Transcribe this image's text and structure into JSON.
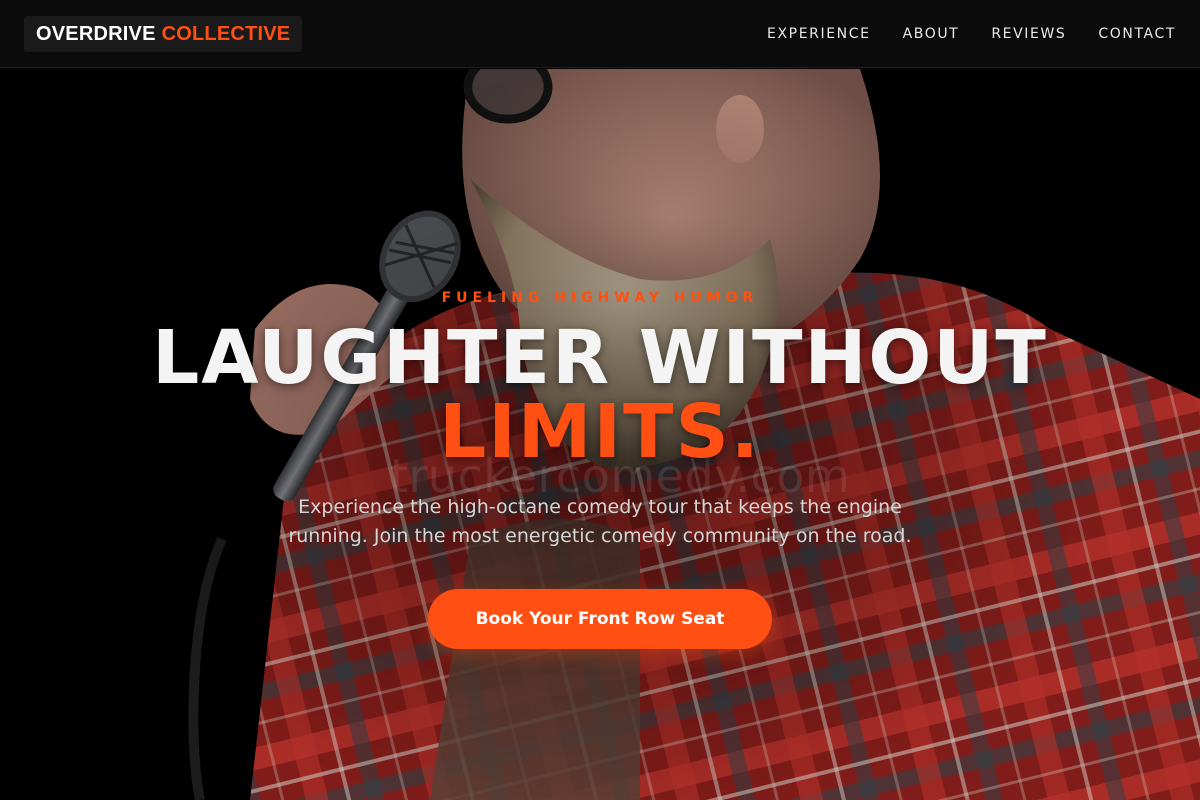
{
  "header": {
    "brand_primary": "OVERDRIVE",
    "brand_accent": "COLLECTIVE",
    "nav": [
      {
        "label": "EXPERIENCE"
      },
      {
        "label": "ABOUT"
      },
      {
        "label": "REVIEWS"
      },
      {
        "label": "CONTACT"
      }
    ]
  },
  "hero": {
    "eyebrow": "FUELING HIGHWAY HUMOR",
    "headline_main": "LAUGHTER WITHOUT",
    "headline_accent": "LIMITS.",
    "subtitle": "Experience the high-octane comedy tour that keeps the engine running. Join the most energetic comedy community on the road.",
    "cta_label": "Book Your Front Row Seat",
    "watermark": "truckercomedy.com",
    "background": "Comedian with beard and glasses holding a microphone, wearing a red plaid flannel shirt"
  },
  "colors": {
    "accent": "#ff4f12",
    "background": "#000000",
    "header": "#0b0b0b"
  }
}
